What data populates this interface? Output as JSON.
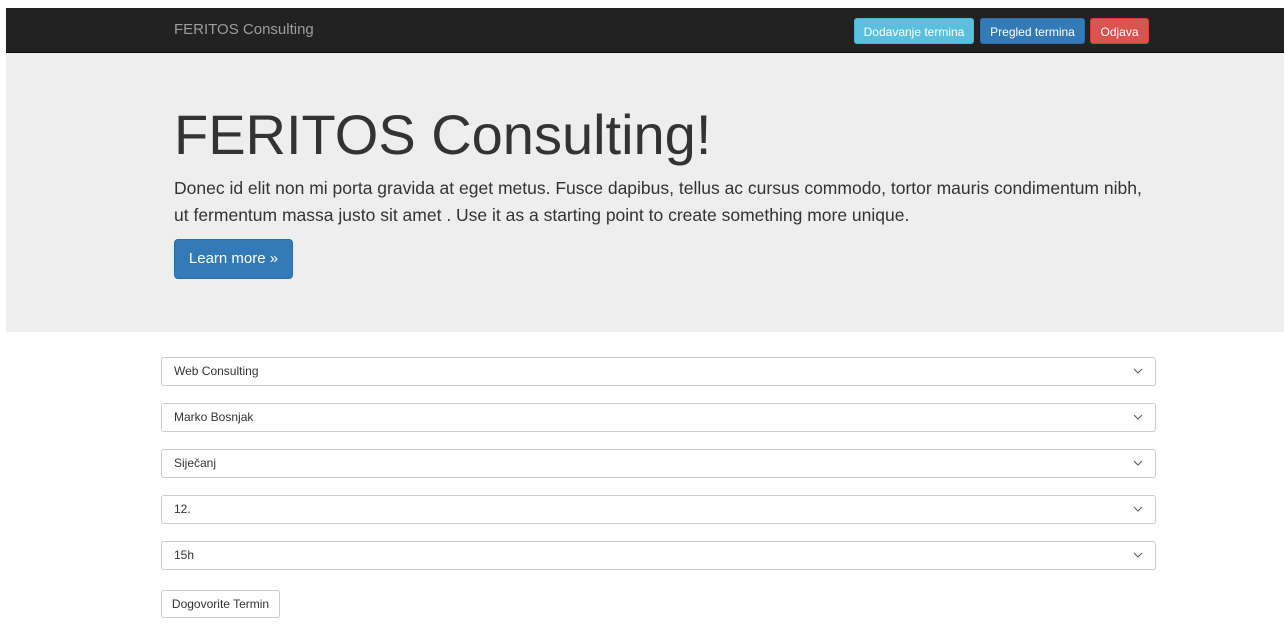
{
  "navbar": {
    "brand": "FERITOS Consulting",
    "buttons": {
      "add_label": "Dodavanje termina",
      "view_label": "Pregled termina",
      "logout_label": "Odjava"
    }
  },
  "jumbotron": {
    "title": "FERITOS Consulting!",
    "text": "Donec id elit non mi porta gravida at eget metus. Fusce dapibus, tellus ac cursus commodo, tortor mauris condimentum nibh, ut fermentum massa justo sit amet . Use it as a starting point to create something more unique.",
    "button_label": "Learn more »"
  },
  "form": {
    "service_value": "Web Consulting",
    "consultant_value": "Marko Bosnjak",
    "month_value": "Siječanj",
    "day_value": "12.",
    "hour_value": "15h",
    "submit_label": "Dogovorite Termin"
  },
  "icons": {
    "dropdown": "chevron-down-icon"
  },
  "colors": {
    "navbar_bg": "#222222",
    "jumbotron_bg": "#eeeeee",
    "info": "#5bc0de",
    "primary": "#337ab7",
    "danger": "#d9534f"
  }
}
